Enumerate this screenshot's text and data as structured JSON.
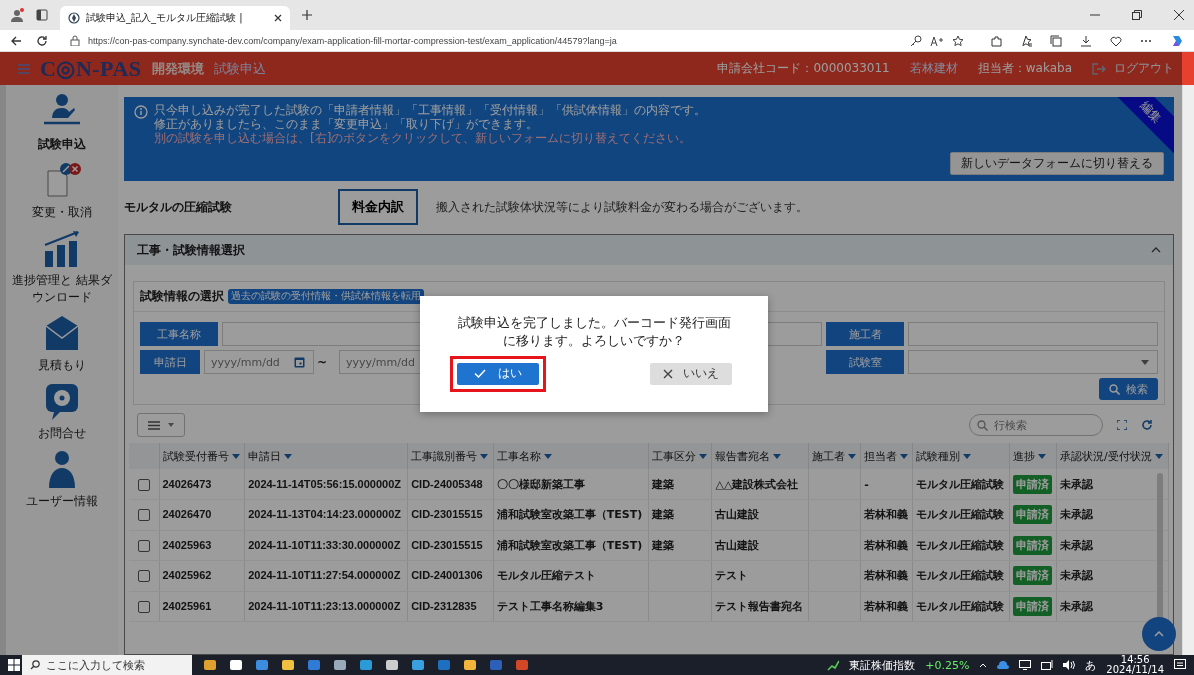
{
  "browser": {
    "tab_title": "試験申込_記入_モルタル圧縮試験 |",
    "url": "https://con-pas-company.synchate-dev.com/company/exam-application-fill-mortar-compression-test/exam_application/44579?lang=ja"
  },
  "header": {
    "logo": "C◎N-PAS",
    "environment": "開発環境",
    "page": "試験申込",
    "company_code": "申請会社コード：0000033011",
    "company": "若林建材",
    "user": "担当者：wakaba",
    "logout": "ログアウト"
  },
  "sidebar": {
    "items": [
      {
        "label": "試験申込",
        "kind": "apply",
        "selected": true
      },
      {
        "label": "変更・取消",
        "kind": "change",
        "selected": false
      },
      {
        "label": "進捗管理と 結果ダウンロード",
        "kind": "progress",
        "selected": false
      },
      {
        "label": "見積もり",
        "kind": "estimate",
        "selected": false
      },
      {
        "label": "お問合せ",
        "kind": "contact",
        "selected": false
      },
      {
        "label": "ユーザー情報",
        "kind": "user",
        "selected": false
      }
    ]
  },
  "banner": {
    "lines": [
      {
        "text": "只今申し込みが完了した試験の「申請者情報」「工事情報」「受付情報」「供試体情報」の内容です。",
        "kind": "info"
      },
      {
        "text": "修正がありましたら、このまま「変更申込」「取り下げ」ができます。",
        "kind": "info"
      },
      {
        "text": "別の試験を申し込む場合は、[右]のボタンをクリックして、新しいフォームに切り替えてください。",
        "kind": "alert"
      }
    ],
    "button": "新しいデータフォームに切り替える",
    "ribbon": "編集"
  },
  "title_row": {
    "title": "モルタルの圧縮試験",
    "fee_button": "料金内訳",
    "note": "搬入された試験体状況等により試験料金が変わる場合がございます。"
  },
  "panel": {
    "title": "工事・試験情報選択",
    "expanded": true
  },
  "selection": {
    "title": "試験情報の選択",
    "hint": "過去の試験の受付情報・供試体情報を転用"
  },
  "filters": {
    "project_label": "工事名称",
    "builder_label": "施工者",
    "date_label": "申請日",
    "date_from_placeholder": "yyyy/mm/dd",
    "range_sep": "~",
    "date_to_placeholder": "yyyy/mm/dd",
    "lab_label": "試験室",
    "search_button": "検索"
  },
  "table": {
    "search_placeholder": "行検索",
    "columns": [
      "試験受付番号",
      "申請日",
      "工事識別番号",
      "工事名称",
      "工事区分",
      "報告書宛名",
      "施工者",
      "担当者",
      "試験種別",
      "進捗",
      "承認状況/受付状況"
    ],
    "rows": [
      {
        "checked": false,
        "cells": [
          "24026473",
          "2024-11-14T05:56:15.000000Z",
          "CID-24005348",
          "〇〇様邸新築工事",
          "建築",
          "△△建設株式会社",
          "",
          "-",
          "モルタル圧縮試験",
          "申請済",
          "未承認"
        ]
      },
      {
        "checked": false,
        "cells": [
          "24026470",
          "2024-11-13T04:14:23.000000Z",
          "CID-23015515",
          "浦和試験室改築工事（TEST)",
          "建築",
          "古山建設",
          "",
          "若林和義",
          "モルタル圧縮試験",
          "申請済",
          "未承認"
        ]
      },
      {
        "checked": false,
        "cells": [
          "24025963",
          "2024-11-10T11:33:30.000000Z",
          "CID-23015515",
          "浦和試験室改築工事（TEST)",
          "建築",
          "古山建設",
          "",
          "若林和義",
          "モルタル圧縮試験",
          "申請済",
          "未承認"
        ]
      },
      {
        "checked": false,
        "cells": [
          "24025962",
          "2024-11-10T11:27:54.000000Z",
          "CID-24001306",
          "モルタル圧縮テスト",
          "",
          "テスト",
          "",
          "若林和義",
          "モルタル圧縮試験",
          "申請済",
          "未承認"
        ]
      },
      {
        "checked": false,
        "cells": [
          "24025961",
          "2024-11-10T11:23:13.000000Z",
          "CID-2312835",
          "テスト工事名称編集3",
          "",
          "テスト報告書宛名",
          "",
          "若林和義",
          "モルタル圧縮試験",
          "申請済",
          "未承認"
        ]
      }
    ]
  },
  "dialog": {
    "message_lines": [
      "試験申込を完了しました。バーコード発行画面",
      "に移ります。よろしいですか？"
    ],
    "yes": "はい",
    "yes_highlighted": true,
    "no": "いいえ"
  },
  "taskbar": {
    "search_placeholder": "ここに入力して検索",
    "stock_name": "東証株価指数",
    "stock_change": "+0.25%",
    "ime": "あ",
    "time": "14:56",
    "date": "2024/11/14"
  }
}
